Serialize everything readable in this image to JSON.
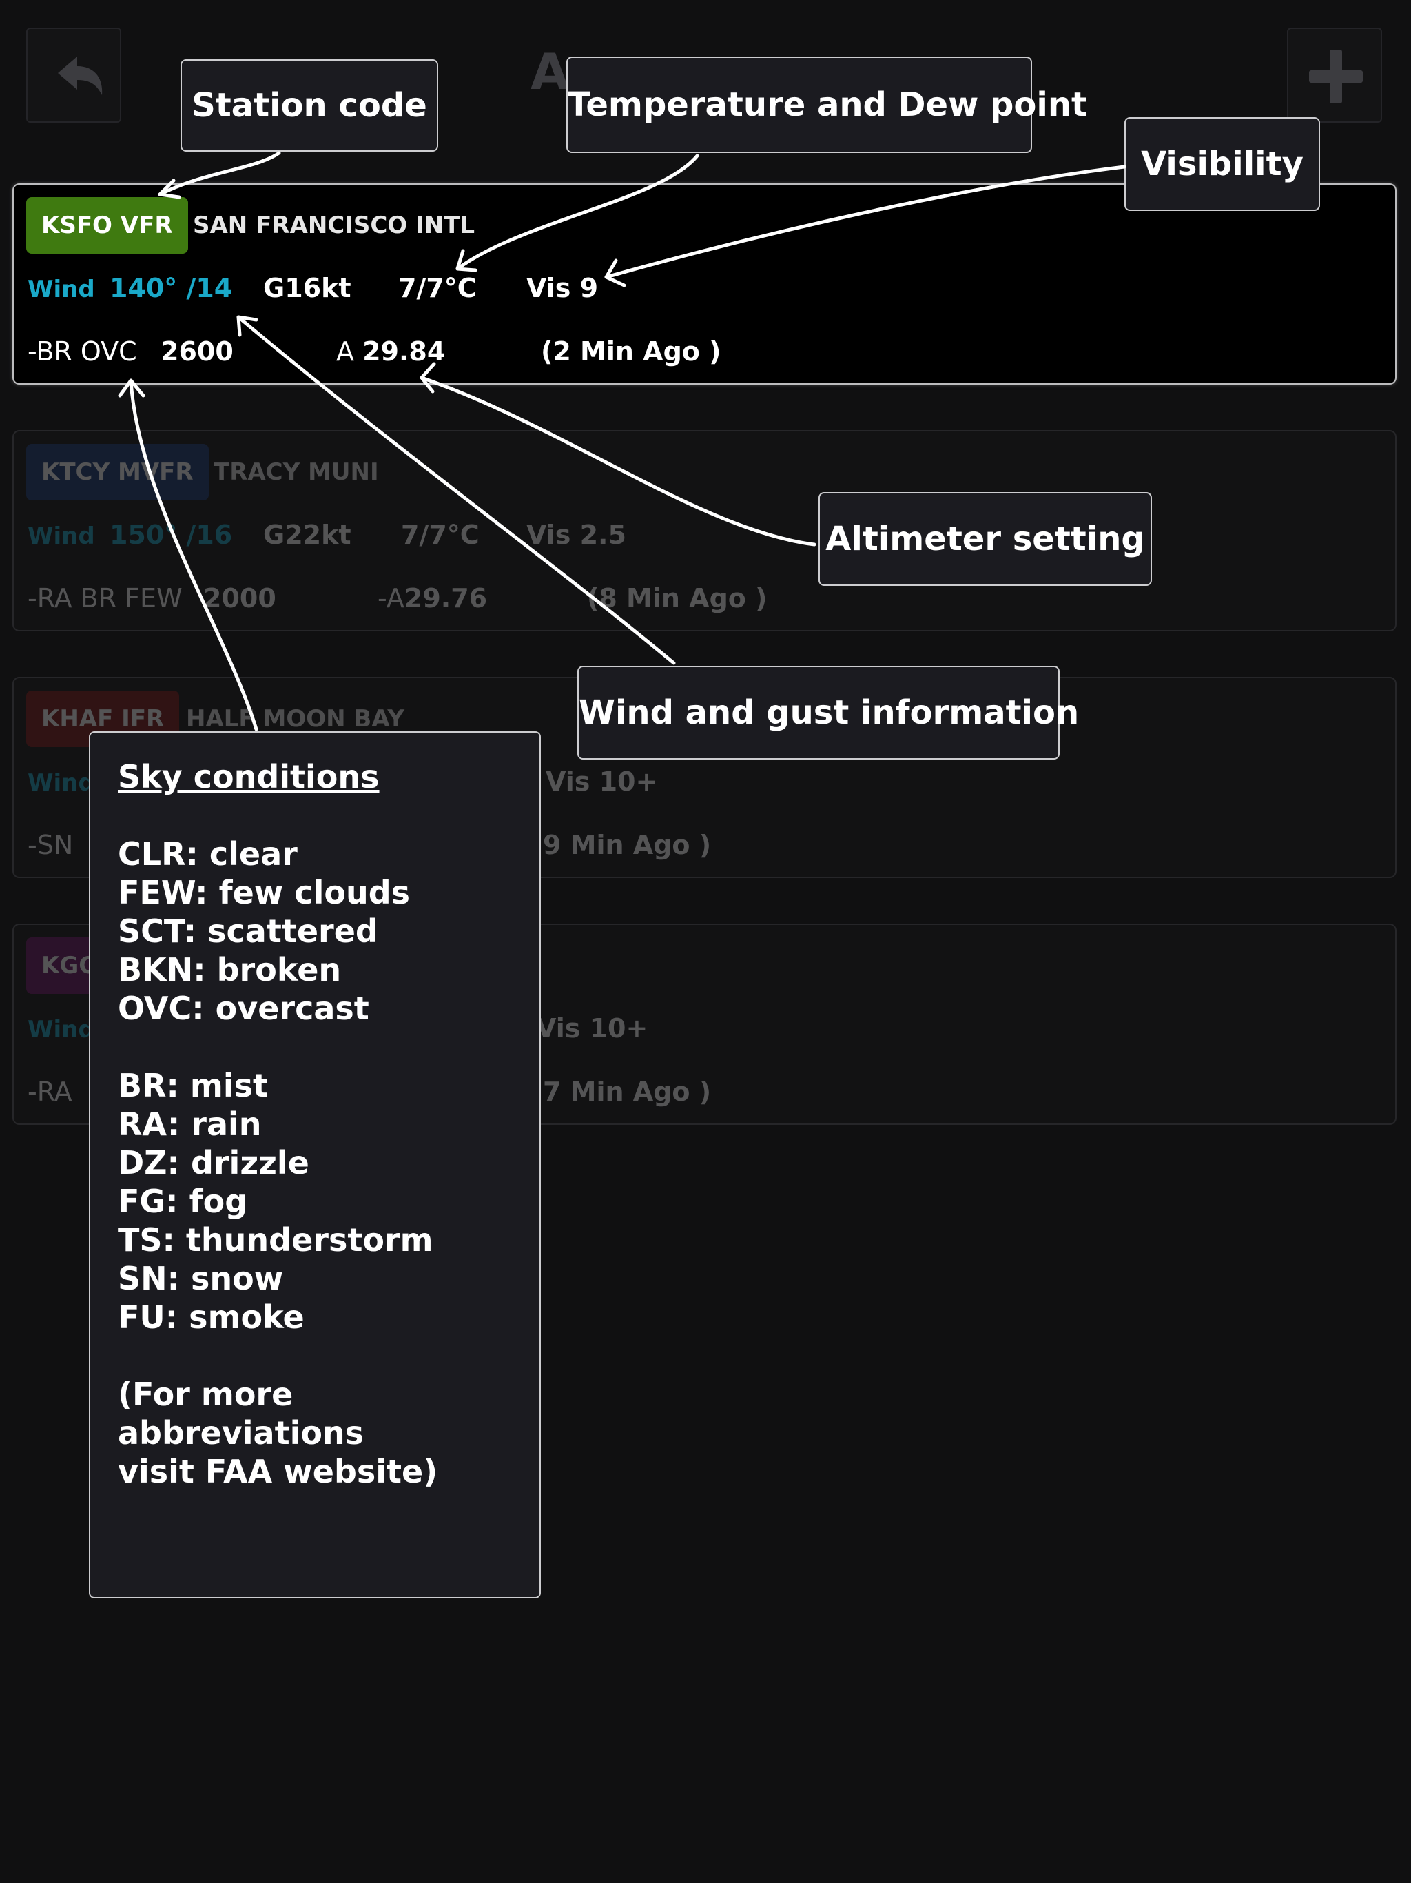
{
  "header": {
    "title": "A",
    "back_icon": "back-arrow-icon",
    "add_icon": "plus-icon"
  },
  "colors": {
    "vfr": "#3f7a10",
    "mvfr": "#1b3a78",
    "ifr": "#7e1717",
    "lifr": "#6d1566",
    "wind": "#1aa9c9"
  },
  "stations": [
    {
      "badge": "KSFO VFR",
      "name": "SAN FRANCISCO INTL",
      "wind_label": "Wind",
      "wind": "140° /14",
      "gust": "G16kt",
      "temp": "7/7°C",
      "vis": "Vis 9",
      "sky": "-BR OVC",
      "ceiling": "2600",
      "alt_prefix": "A",
      "alt": "29.84",
      "age": "(2 Min Ago )"
    },
    {
      "badge": "KTCY MVFR",
      "name": "TRACY MUNI",
      "wind_label": "Wind",
      "wind": "150° /16",
      "gust": "G22kt",
      "temp": "7/7°C",
      "vis": "Vis 2.5",
      "sky": "-RA BR FEW",
      "ceiling": "2000",
      "alt_prefix": "-A",
      "alt": "29.76",
      "age": "(8 Min Ago )"
    },
    {
      "badge": "KHAF IFR",
      "name": "HALF MOON BAY",
      "wind_label": "Wind",
      "vis": "Vis 10+",
      "sky": "-SN",
      "age": "9 Min Ago )"
    },
    {
      "badge": "KGC",
      "wind_label": "Wind",
      "vis": "Vis 10+",
      "sky": "-RA",
      "age": "7 Min Ago )"
    }
  ],
  "callouts": {
    "station_code": "Station code",
    "temp_dew": "Temperature and Dew point",
    "visibility": "Visibility",
    "altimeter": "Altimeter setting",
    "wind_gust": "Wind and gust information"
  },
  "legend": {
    "heading": "Sky conditions",
    "group1": [
      "CLR: clear",
      "FEW: few clouds",
      "SCT: scattered",
      "BKN: broken",
      "OVC: overcast"
    ],
    "group2": [
      "BR: mist",
      "RA: rain",
      "DZ: drizzle",
      "FG: fog",
      "TS: thunderstorm",
      "SN: snow",
      "FU: smoke"
    ],
    "footer": [
      "(For more abbreviations",
      "visit FAA website)"
    ]
  }
}
